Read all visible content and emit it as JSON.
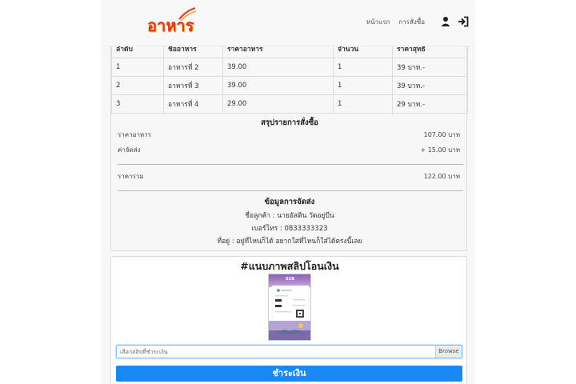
{
  "nav": {
    "logo_text": "อาหาร",
    "links": [
      "หน้าแรก",
      "การสั่งซื้อ"
    ],
    "icons": [
      "user-icon",
      "sign-out-icon"
    ]
  },
  "order": {
    "headers": [
      "ลำดับ",
      "ชื่ออาหาร",
      "ราคาอาหาร",
      "จำนวน",
      "ราคาสุทธิ"
    ],
    "rows": [
      [
        "1",
        "อาหารที่ 2",
        "39.00",
        "1",
        "39 บาท.-"
      ],
      [
        "2",
        "อาหารที่ 3",
        "39.00",
        "1",
        "39 บาท.-"
      ],
      [
        "3",
        "อาหารที่ 4",
        "29.00",
        "1",
        "29 บาท.-"
      ]
    ]
  },
  "summary": {
    "title": "สรุปรายการสั่งซื้อ",
    "food_label": "ราคาอาหาร",
    "food_value": "107.00 บาท",
    "ship_label": "ค่าจัดส่ง",
    "ship_value": "+ 15.00 บาท",
    "total_label": "ราคารวม",
    "total_value": "122.00 บาท"
  },
  "shipping": {
    "title": "ข้อมูลการจัดส่ง",
    "name": "ชื่อลูกค้า : นายอัสติน วัดอยู่บีน",
    "phone": "เบอร์โทร : 0833333323",
    "address": "ที่อยู่ : อยู่ที่ไหนก็ได้ อยากใส่ที่ไหนก็ใส่ได้ตรงนี้เลย"
  },
  "slip": {
    "title": "#แนบภาพสลิปโอนเงิน",
    "file_placeholder": "เลือกสลิปที่ชำระเงิน",
    "browse_label": "Browse",
    "pay_label": "ชำระเงิน",
    "bank_label": "SCB"
  }
}
